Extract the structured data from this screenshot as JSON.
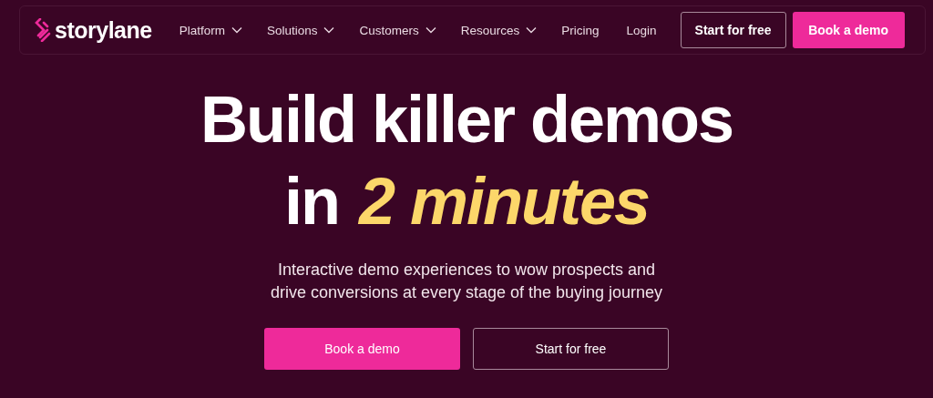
{
  "brand": {
    "name": "storylane"
  },
  "nav": [
    {
      "label": "Platform",
      "kind": "dropdown"
    },
    {
      "label": "Solutions",
      "kind": "dropdown"
    },
    {
      "label": "Customers",
      "kind": "dropdown"
    },
    {
      "label": "Resources",
      "kind": "dropdown"
    },
    {
      "label": "Pricing",
      "kind": "link"
    },
    {
      "label": "Login",
      "kind": "link"
    }
  ],
  "nav_buttons": [
    {
      "label": "Start for free",
      "kind": "outline"
    },
    {
      "label": "Book a demo",
      "kind": "primary"
    }
  ],
  "hero": {
    "title_line_1": "Build killer demos",
    "title_line_2_prefix": "in",
    "title_line_2_highlight": "2 minutes",
    "subtitle": "Interactive demo experiences to wow prospects and drive conversions at every stage of the buying journey",
    "buttons": [
      {
        "label": "Book a demo",
        "kind": "primary"
      },
      {
        "label": "Start for free",
        "kind": "outline"
      }
    ]
  }
}
